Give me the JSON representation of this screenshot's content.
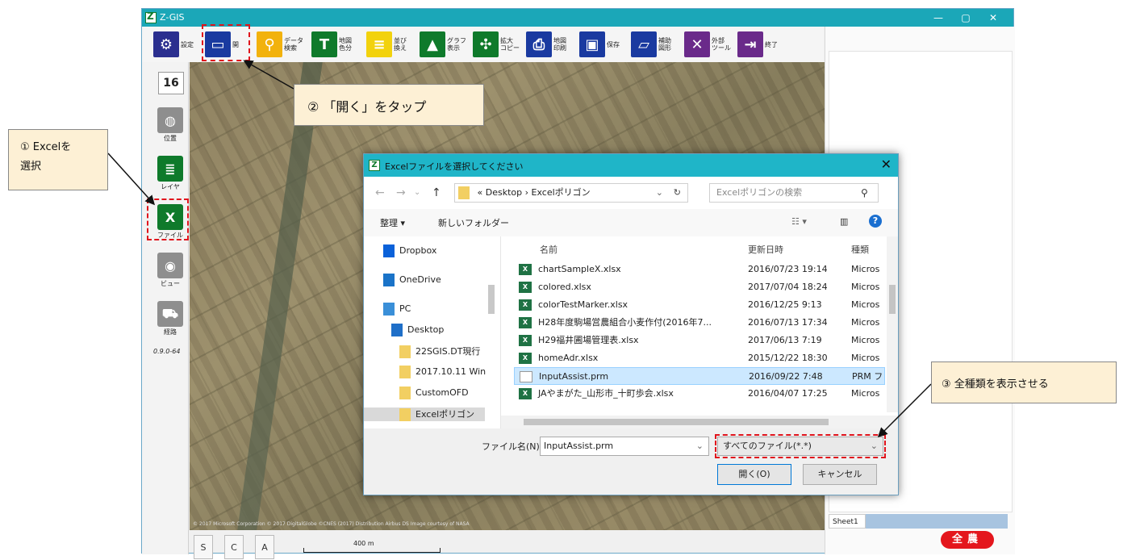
{
  "app": {
    "title": "Z-GIS",
    "window_controls": [
      "—",
      "▢",
      "✕"
    ]
  },
  "toolbar": [
    {
      "name": "settings",
      "label": "設定",
      "icon": "gear-icon",
      "color": "#2b2f8f",
      "glyph": "⚙"
    },
    {
      "name": "open",
      "label": "開",
      "icon": "folder-open-icon",
      "color": "#1a3aa0",
      "glyph": "▭"
    },
    {
      "name": "data-search",
      "label": "データ\n検索",
      "icon": "search-icon",
      "color": "#f2b20d",
      "glyph": "⚲"
    },
    {
      "name": "map-color",
      "label": "地図\n色分",
      "icon": "paint-roller-icon",
      "color": "#0f7a2b",
      "glyph": "T"
    },
    {
      "name": "sort",
      "label": "並び\n換え",
      "icon": "sort-icon",
      "color": "#f2d20d",
      "glyph": "≡"
    },
    {
      "name": "graph",
      "label": "グラフ\n表示",
      "icon": "chart-icon",
      "color": "#0f7a2b",
      "glyph": "▲"
    },
    {
      "name": "zoom-copy",
      "label": "拡大\nコピー",
      "icon": "expand-icon",
      "color": "#0f7a2b",
      "glyph": "✣"
    },
    {
      "name": "map-print",
      "label": "地図\n印刷",
      "icon": "printer-icon",
      "color": "#1a3aa0",
      "glyph": "⎙"
    },
    {
      "name": "save",
      "label": "保存",
      "icon": "floppy-icon",
      "color": "#1a3aa0",
      "glyph": "▣"
    },
    {
      "name": "aux-shape",
      "label": "補助\n図形",
      "icon": "shape-icon",
      "color": "#1a3aa0",
      "glyph": "▱"
    },
    {
      "name": "external-tools",
      "label": "外部\nツール",
      "icon": "tools-icon",
      "color": "#6a2a8a",
      "glyph": "✕"
    },
    {
      "name": "exit",
      "label": "終了",
      "icon": "exit-icon",
      "color": "#6a2a8a",
      "glyph": "⇥"
    }
  ],
  "left_panel": {
    "zoom_value": "16",
    "items": [
      {
        "name": "position",
        "label": "位置",
        "icon": "globe-icon",
        "color": "#8e8e8e",
        "glyph": "◍"
      },
      {
        "name": "layer",
        "label": "レイヤ",
        "icon": "layers-icon",
        "color": "#0f7a2b",
        "glyph": "≣"
      },
      {
        "name": "file",
        "label": "ファイル",
        "icon": "excel-icon",
        "color": "#0f7a2b",
        "glyph": "X"
      },
      {
        "name": "view",
        "label": "ビュー",
        "icon": "eye-icon",
        "color": "#8e8e8e",
        "glyph": "◉"
      },
      {
        "name": "route",
        "label": "経路",
        "icon": "car-icon",
        "color": "#8e8e8e",
        "glyph": "⛟"
      }
    ],
    "version": "0.9.0-64"
  },
  "map": {
    "attribution": "© 2017 Microsoft Corporation  © 2017 DigitalGlobe  ©CNES (2017) Distribution Airbus DS  Image courtesy of NASA",
    "scale_label": "400 m",
    "bottom_buttons": [
      "S",
      "C",
      "A"
    ]
  },
  "right_panel": {
    "sheet_tab": "Sheet1",
    "logo_text": "全農"
  },
  "dialog": {
    "title": "Excelファイルを選択してください",
    "close": "✕",
    "nav": {
      "back": "←",
      "forward": "→",
      "recent": "⌄",
      "up": "↑"
    },
    "address": [
      "«",
      "Desktop",
      "›",
      "Excelポリゴン"
    ],
    "search_placeholder": "Excelポリゴンの検索",
    "commands": {
      "organize": "整理 ▾",
      "new_folder": "新しいフォルダー",
      "view": "☷ ▾",
      "pane": "▥",
      "help": "?"
    },
    "nav_pane": [
      {
        "label": "Dropbox",
        "icon": "dropbox-icon"
      },
      {
        "label": "OneDrive",
        "icon": "onedrive-icon"
      },
      {
        "label": "PC",
        "icon": "pc-icon"
      },
      {
        "label": "Desktop",
        "icon": "desktop-icon"
      },
      {
        "label": "22SGIS.DT現行",
        "icon": "folder-icon"
      },
      {
        "label": "2017.10.11 Win",
        "icon": "folder-icon"
      },
      {
        "label": "CustomOFD",
        "icon": "folder-icon"
      },
      {
        "label": "Excelポリゴン",
        "icon": "folder-icon"
      }
    ],
    "columns": {
      "name": "名前",
      "date": "更新日時",
      "type": "種類"
    },
    "files": [
      {
        "name": "chartSampleX.xlsx",
        "date": "2016/07/23 19:14",
        "type": "Micros",
        "kind": "xl"
      },
      {
        "name": "colored.xlsx",
        "date": "2017/07/04 18:24",
        "type": "Micros",
        "kind": "xl"
      },
      {
        "name": "colorTestMarker.xlsx",
        "date": "2016/12/25 9:13",
        "type": "Micros",
        "kind": "xl"
      },
      {
        "name": "H28年度駒場営農組合小麦作付(2016年7...",
        "date": "2016/07/13 17:34",
        "type": "Micros",
        "kind": "xl"
      },
      {
        "name": "H29福井圃場管理表.xlsx",
        "date": "2017/06/13 7:19",
        "type": "Micros",
        "kind": "xl"
      },
      {
        "name": "homeAdr.xlsx",
        "date": "2015/12/22 18:30",
        "type": "Micros",
        "kind": "xl"
      },
      {
        "name": "InputAssist.prm",
        "date": "2016/09/22 7:48",
        "type": "PRM フ",
        "kind": "doc",
        "selected": true
      },
      {
        "name": "JAやまがた_山形市_十町歩会.xlsx",
        "date": "2016/04/07 17:25",
        "type": "Micros",
        "kind": "xl"
      }
    ],
    "filename_label": "ファイル名(N):",
    "filename_value": "InputAssist.prm",
    "filetype_value": "すべてのファイル(*.*)",
    "open_button": "開く(O)",
    "cancel_button": "キャンセル"
  },
  "callouts": {
    "c1_line1": "① Excelを",
    "c1_line2": "選択",
    "c2": "② 「開く」をタップ",
    "c3": "③ 全種類を表示させる"
  },
  "colors": {
    "titlebar": "#1ba7b8",
    "highlight_dash": "#e0141c",
    "callout_bg": "#fdf0d5"
  }
}
